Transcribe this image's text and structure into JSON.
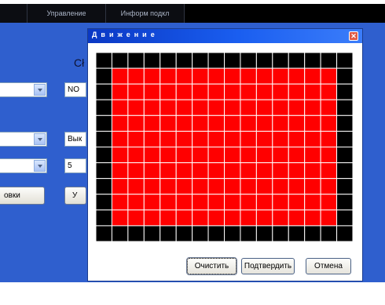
{
  "tabs": [
    {
      "label": "Управление"
    },
    {
      "label": "Информ подкл"
    }
  ],
  "background_form": {
    "heading": "Cł",
    "field1_value": "NO",
    "field2_value": "Вык",
    "field3_value": "5",
    "left_button_label": "овки",
    "mid_button_label": "У"
  },
  "dialog": {
    "title": "Движение",
    "close_glyph": "✕",
    "grid": {
      "columns": 16,
      "rows": 12,
      "active_color": "#ff0000",
      "inactive_color": "#000000",
      "line_color": "#ffffff",
      "active_cells": "all cells except columns 1 and 16 and row 1 and row 12"
    },
    "buttons": {
      "clear": "Очистить",
      "confirm": "Подтвердить",
      "cancel": "Отмена"
    }
  },
  "colors": {
    "panel_blue": "#2f5fce",
    "titlebar_blue": "#0a38c4"
  }
}
